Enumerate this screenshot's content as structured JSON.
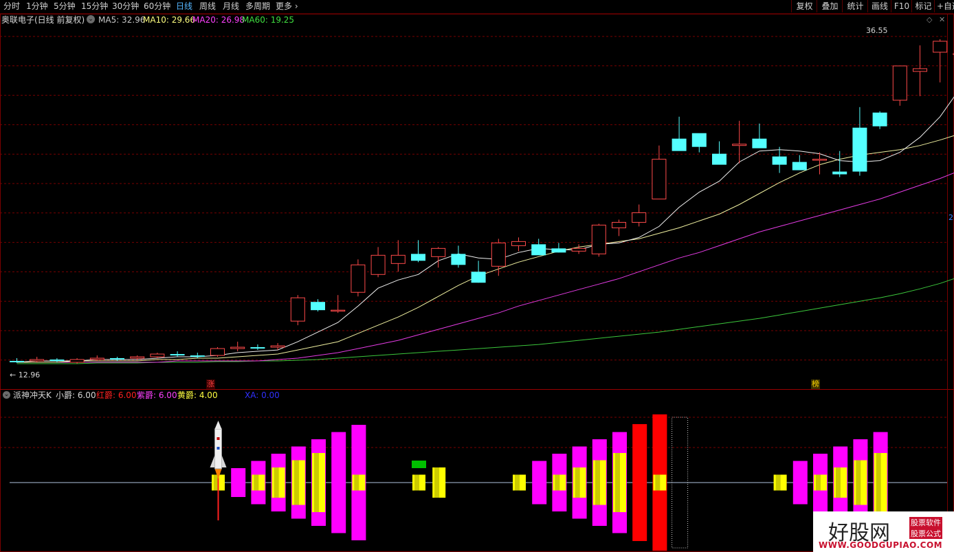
{
  "toolbar": {
    "timeframes": [
      "分时",
      "1分钟",
      "5分钟",
      "15分钟",
      "30分钟",
      "60分钟",
      "日线",
      "周线",
      "月线",
      "多周期",
      "更多"
    ],
    "active": "日线",
    "right_buttons": [
      "复权",
      "叠加",
      "统计",
      "画线",
      "F10",
      "标记",
      "+自选"
    ]
  },
  "main_panel": {
    "title": "奥联电子(日线 前复权)",
    "indicators": [
      {
        "label": "MA5: 32.96",
        "color": "#ffffff"
      },
      {
        "label": "MA10: 29.66",
        "color": "#ffff80"
      },
      {
        "label": "MA20: 26.98",
        "color": "#ff40ff"
      },
      {
        "label": "MA60: 19.25",
        "color": "#40e040"
      }
    ],
    "high_marker": "36.55",
    "low_marker": "12.96",
    "right_marker": "2",
    "markers": [
      {
        "text": "涨",
        "color": "#ff4040"
      },
      {
        "text": "榜",
        "color": "#ffd700"
      }
    ]
  },
  "sub_panel": {
    "title": "派神冲天K",
    "values": [
      {
        "label": "小爵: 6.00",
        "color": "#d0d0d0"
      },
      {
        "label": "红爵: 6.00",
        "color": "#ff2020"
      },
      {
        "label": "紫爵: 6.00",
        "color": "#ff40ff"
      },
      {
        "label": "黄爵: 4.00",
        "color": "#ffff40"
      },
      {
        "label": "XA: 0.00",
        "color": "#3030ff"
      }
    ]
  },
  "watermark": {
    "name": "好股网",
    "tag1": "股票软件",
    "tag2": "股票公式",
    "url": "WWW.GOODGUPIAO.COM"
  },
  "colors": {
    "up": "#ff4a4a",
    "down": "#54ffff",
    "grid": "#7a0000",
    "magenta": "#ff00ff",
    "yellow": "#ffff00",
    "red": "#ff0000"
  },
  "chart_data": {
    "type": "candlestick",
    "date_axis": "daily",
    "price_range": [
      12.96,
      36.55
    ],
    "ohlc": [
      [
        13.1,
        13.3,
        12.96,
        13.0
      ],
      [
        13.1,
        13.4,
        13.0,
        13.2
      ],
      [
        13.2,
        13.3,
        13.0,
        13.1
      ],
      [
        13.0,
        13.3,
        12.9,
        13.2
      ],
      [
        13.2,
        13.5,
        13.1,
        13.3
      ],
      [
        13.3,
        13.4,
        13.1,
        13.2
      ],
      [
        13.3,
        13.5,
        13.2,
        13.4
      ],
      [
        13.4,
        13.7,
        13.3,
        13.6
      ],
      [
        13.6,
        13.8,
        13.4,
        13.5
      ],
      [
        13.5,
        13.7,
        13.3,
        13.4
      ],
      [
        13.5,
        14.1,
        13.4,
        14.0
      ],
      [
        14.0,
        14.5,
        13.8,
        14.1
      ],
      [
        14.1,
        14.3,
        13.9,
        14.0
      ],
      [
        14.1,
        14.4,
        13.9,
        14.2
      ],
      [
        16.0,
        17.9,
        15.7,
        17.7
      ],
      [
        17.4,
        17.6,
        16.7,
        16.8
      ],
      [
        16.8,
        17.9,
        16.6,
        16.8
      ],
      [
        18.1,
        20.5,
        17.8,
        20.1
      ],
      [
        19.4,
        21.4,
        19.2,
        20.8
      ],
      [
        20.2,
        21.9,
        19.6,
        20.8
      ],
      [
        20.9,
        21.9,
        20.3,
        20.4
      ],
      [
        20.7,
        21.4,
        19.9,
        21.3
      ],
      [
        20.9,
        21.5,
        19.9,
        20.1
      ],
      [
        19.6,
        20.4,
        18.8,
        18.8
      ],
      [
        20.0,
        22.0,
        19.3,
        21.7
      ],
      [
        21.5,
        22.1,
        21.1,
        21.8
      ],
      [
        21.6,
        22.0,
        21.1,
        20.8
      ],
      [
        21.3,
        21.7,
        21.0,
        21.0
      ],
      [
        21.1,
        21.6,
        20.9,
        21.3
      ],
      [
        20.9,
        23.1,
        20.7,
        23.0
      ],
      [
        22.8,
        23.4,
        22.2,
        23.2
      ],
      [
        23.2,
        24.5,
        22.9,
        23.9
      ],
      [
        24.9,
        28.8,
        24.9,
        27.8
      ],
      [
        29.3,
        30.9,
        29.2,
        28.4
      ],
      [
        29.7,
        29.2,
        28.3,
        28.7
      ],
      [
        28.2,
        29.1,
        27.7,
        27.4
      ],
      [
        28.8,
        30.6,
        27.5,
        28.9
      ],
      [
        29.3,
        30.4,
        28.7,
        28.6
      ],
      [
        28.0,
        28.7,
        26.8,
        27.4
      ],
      [
        27.6,
        28.1,
        27.1,
        27.0
      ],
      [
        27.8,
        28.3,
        26.7,
        27.8
      ],
      [
        26.9,
        28.4,
        26.5,
        26.7
      ],
      [
        30.1,
        31.6,
        26.6,
        26.9
      ],
      [
        31.2,
        31.3,
        30.0,
        30.2
      ],
      [
        32.1,
        34.6,
        31.7,
        34.6
      ],
      [
        34.2,
        36.1,
        32.4,
        34.4
      ],
      [
        35.6,
        36.55,
        33.4,
        36.4
      ],
      [
        35.5,
        36.0,
        33.1,
        35.5
      ]
    ],
    "ma5": [
      13.0,
      13.1,
      13.1,
      13.1,
      13.2,
      13.2,
      13.2,
      13.3,
      13.4,
      13.4,
      13.5,
      13.7,
      13.8,
      13.9,
      14.5,
      15.2,
      15.9,
      17.1,
      18.4,
      19.0,
      19.4,
      20.4,
      20.9,
      20.6,
      20.5,
      21.0,
      21.3,
      21.2,
      21.2,
      21.6,
      21.7,
      22.1,
      22.9,
      24.3,
      25.4,
      26.2,
      27.6,
      28.4,
      28.5,
      28.4,
      28.2,
      27.7,
      27.6,
      27.7,
      28.3,
      29.4,
      30.9,
      32.96
    ],
    "ma10": [
      13.0,
      13.0,
      13.0,
      13.1,
      13.1,
      13.1,
      13.1,
      13.2,
      13.2,
      13.3,
      13.3,
      13.4,
      13.5,
      13.6,
      13.9,
      14.2,
      14.5,
      15.1,
      15.7,
      16.3,
      17.0,
      17.8,
      18.6,
      19.3,
      19.8,
      20.3,
      20.7,
      21.1,
      21.4,
      21.6,
      21.8,
      22.0,
      22.4,
      22.8,
      23.3,
      23.8,
      24.5,
      25.3,
      26.1,
      26.8,
      27.4,
      27.8,
      28.1,
      28.3,
      28.5,
      28.8,
      29.2,
      29.66
    ],
    "ma20": [
      13.0,
      13.0,
      13.0,
      13.0,
      13.0,
      13.0,
      13.0,
      13.0,
      13.1,
      13.1,
      13.1,
      13.1,
      13.1,
      13.2,
      13.3,
      13.5,
      13.7,
      14.0,
      14.3,
      14.6,
      15.0,
      15.4,
      15.8,
      16.2,
      16.6,
      17.1,
      17.5,
      17.9,
      18.3,
      18.7,
      19.1,
      19.6,
      20.1,
      20.6,
      21.0,
      21.5,
      22.0,
      22.5,
      22.9,
      23.3,
      23.7,
      24.1,
      24.5,
      24.9,
      25.4,
      25.9,
      26.4,
      26.98
    ],
    "ma60": [
      12.9,
      12.9,
      12.9,
      12.9,
      12.95,
      12.95,
      12.95,
      13.0,
      13.0,
      13.0,
      13.05,
      13.05,
      13.1,
      13.1,
      13.15,
      13.2,
      13.3,
      13.4,
      13.5,
      13.6,
      13.7,
      13.8,
      13.9,
      14.0,
      14.1,
      14.2,
      14.3,
      14.45,
      14.6,
      14.75,
      14.9,
      15.05,
      15.2,
      15.4,
      15.6,
      15.8,
      16.0,
      16.2,
      16.45,
      16.7,
      16.95,
      17.2,
      17.45,
      17.7,
      18.0,
      18.35,
      18.75,
      19.25
    ],
    "sub_bars": [
      {
        "i": 10,
        "magenta": 0,
        "yellow": 1,
        "red": 0,
        "rocket": true
      },
      {
        "i": 11,
        "magenta": 1,
        "yellow": 0,
        "red": 0
      },
      {
        "i": 12,
        "magenta": 2,
        "yellow": 1,
        "red": 0
      },
      {
        "i": 13,
        "magenta": 3,
        "yellow": 2,
        "red": 0
      },
      {
        "i": 14,
        "magenta": 4,
        "yellow": 3,
        "red": 0
      },
      {
        "i": 15,
        "magenta": 5,
        "yellow": 4,
        "red": 0
      },
      {
        "i": 16,
        "magenta": 6,
        "yellow": 0,
        "red": 0
      },
      {
        "i": 17,
        "magenta": 7,
        "yellow": 1,
        "red": 0
      },
      {
        "i": 20,
        "magenta": 0,
        "yellow": 1,
        "red": 0,
        "green": true
      },
      {
        "i": 21,
        "magenta": 0,
        "yellow": 2,
        "red": 0
      },
      {
        "i": 25,
        "magenta": 0,
        "yellow": 1,
        "red": 0
      },
      {
        "i": 26,
        "magenta": 2,
        "yellow": 0,
        "red": 0
      },
      {
        "i": 27,
        "magenta": 3,
        "yellow": 1,
        "red": 0
      },
      {
        "i": 28,
        "magenta": 4,
        "yellow": 2,
        "red": 0
      },
      {
        "i": 29,
        "magenta": 5,
        "yellow": 3,
        "red": 0
      },
      {
        "i": 30,
        "magenta": 6,
        "yellow": 4,
        "red": 0
      },
      {
        "i": 31,
        "magenta": 0,
        "yellow": 0,
        "red": 6
      },
      {
        "i": 32,
        "magenta": 0,
        "yellow": 1,
        "red": 7
      },
      {
        "i": 33,
        "cursor": true
      },
      {
        "i": 38,
        "magenta": 0,
        "yellow": 1,
        "red": 0
      },
      {
        "i": 39,
        "magenta": 2,
        "yellow": 0,
        "red": 0
      },
      {
        "i": 40,
        "magenta": 3,
        "yellow": 1,
        "red": 0
      },
      {
        "i": 41,
        "magenta": 4,
        "yellow": 2,
        "red": 0
      },
      {
        "i": 42,
        "magenta": 5,
        "yellow": 3,
        "red": 0
      },
      {
        "i": 43,
        "magenta": 6,
        "yellow": 4,
        "red": 0
      }
    ]
  }
}
